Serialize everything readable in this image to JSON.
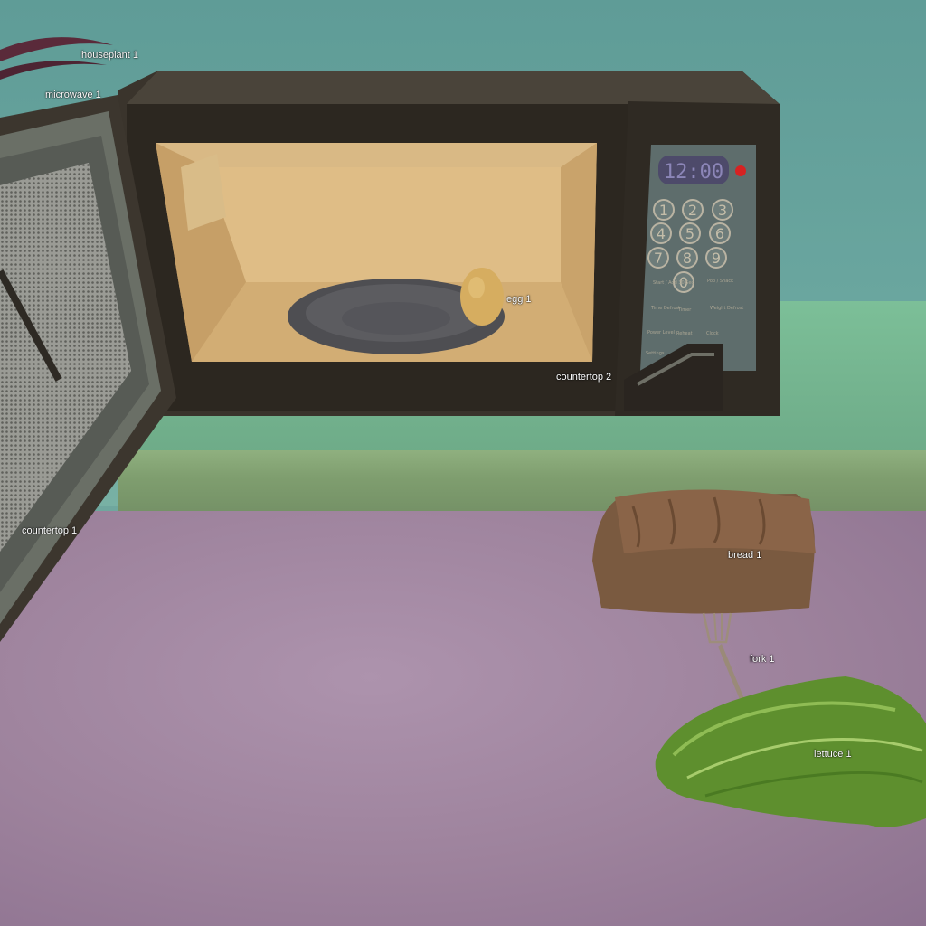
{
  "labels": {
    "houseplant": "houseplant 1",
    "microwave": "microwave 1",
    "egg": "egg 1",
    "countertop2": "countertop 2",
    "countertop1": "countertop 1",
    "bread": "bread 1",
    "fork": "fork 1",
    "lettuce": "lettuce 1"
  },
  "microwave": {
    "clock": "12:00",
    "keys": [
      "1",
      "2",
      "3",
      "4",
      "5",
      "6",
      "7",
      "8",
      "9",
      "0"
    ],
    "panel_text": [
      "Start / Add 30 Sec",
      "Pop / Snack",
      "Time Defrost",
      "Timer",
      "Weight Defrost",
      "Power Level",
      "Reheat",
      "Clock",
      "Settings"
    ]
  },
  "colors": {
    "wall": "#6aa69f",
    "counter_back": "#7cbf98",
    "counter_top": "#a089a0",
    "microwave_body": "#3a342c",
    "microwave_interior": "#d6b27a",
    "panel": "#5e6d6c"
  }
}
